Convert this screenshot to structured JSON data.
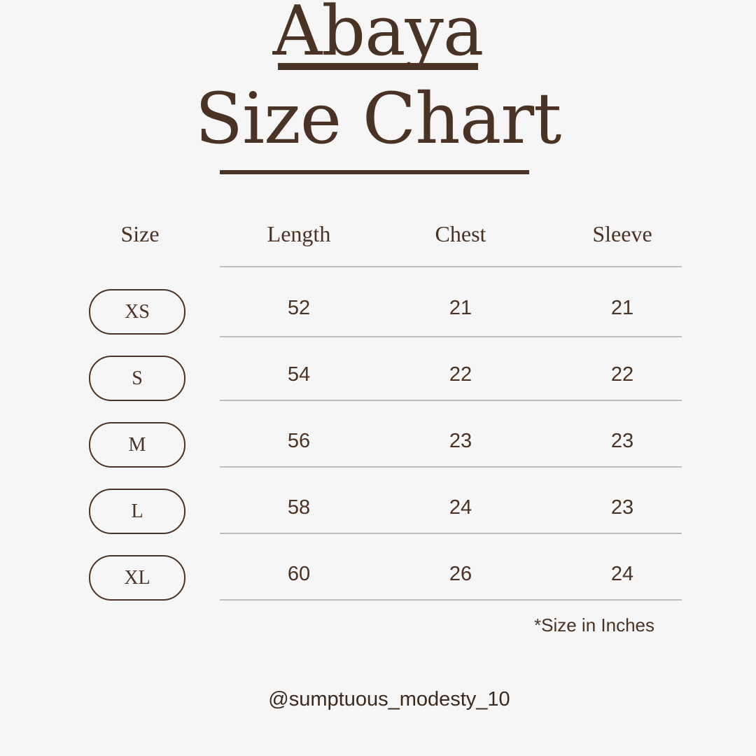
{
  "title": {
    "line1": "Abaya",
    "line2": "Size Chart"
  },
  "table": {
    "headers": [
      "Size",
      "Length",
      "Chest",
      "Sleeve"
    ],
    "rows": [
      {
        "size": "XS",
        "length": "52",
        "chest": "21",
        "sleeve": "21"
      },
      {
        "size": "S",
        "length": "54",
        "chest": "22",
        "sleeve": "22"
      },
      {
        "size": "M",
        "length": "56",
        "chest": "23",
        "sleeve": "23"
      },
      {
        "size": "L",
        "length": "58",
        "chest": "24",
        "sleeve": "23"
      },
      {
        "size": "XL",
        "length": "60",
        "chest": "26",
        "sleeve": "24"
      }
    ]
  },
  "note": "*Size in Inches",
  "handle": "@sumptuous_modesty_10",
  "colors": {
    "background": "#f6f6f6",
    "text": "#4a3324",
    "rule": "#bdbdbd"
  }
}
